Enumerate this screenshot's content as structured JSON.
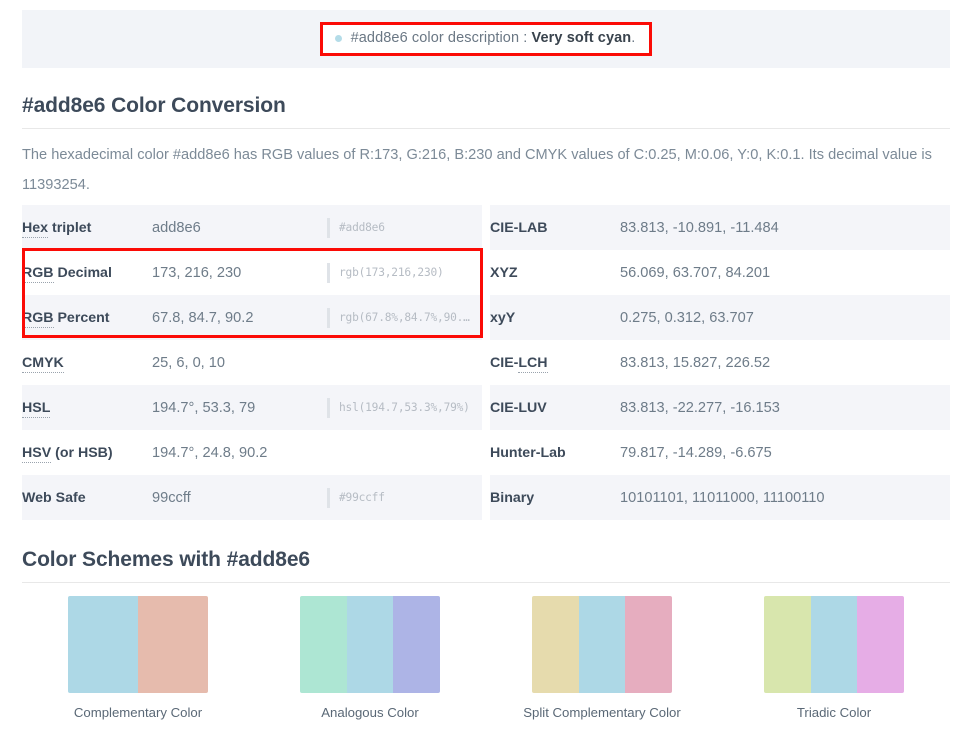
{
  "banner": {
    "bullet": "bullet-dot",
    "prefix": "#add8e6 color description : ",
    "name": "Very soft cyan",
    "suffix": "."
  },
  "conversion": {
    "heading": "#add8e6 Color Conversion",
    "intro": "The hexadecimal color #add8e6 has RGB values of R:173, G:216, B:230 and CMYK values of C:0.25, M:0.06, Y:0, K:0.1. Its decimal value is 11393254.",
    "left_rows": [
      {
        "label": "Hex triplet",
        "label_dotted": "Hex",
        "label_rest": " triplet",
        "value": "add8e6",
        "code": "#add8e6"
      },
      {
        "label": "RGB Decimal",
        "label_dotted": "RGB",
        "label_rest": " Decimal",
        "value": "173, 216, 230",
        "code": "rgb(173,216,230)"
      },
      {
        "label": "RGB Percent",
        "label_dotted": "RGB",
        "label_rest": " Percent",
        "value": "67.8, 84.7, 90.2",
        "code": "rgb(67.8%,84.7%,90.…"
      },
      {
        "label": "CMYK",
        "label_dotted": "CMYK",
        "label_rest": "",
        "value": "25, 6, 0, 10",
        "code": ""
      },
      {
        "label": "HSL",
        "label_dotted": "HSL",
        "label_rest": "",
        "value": "194.7°, 53.3, 79",
        "code": "hsl(194.7,53.3%,79%)"
      },
      {
        "label": "HSV (or HSB)",
        "label_dotted": "HSV",
        "label_rest": " (or HSB)",
        "value": "194.7°, 24.8, 90.2",
        "code": ""
      },
      {
        "label": "Web Safe",
        "label_dotted": "",
        "label_rest": "Web Safe",
        "value": "99ccff",
        "code": "#99ccff"
      }
    ],
    "right_rows": [
      {
        "label": "CIE-LAB",
        "label_dotted": "",
        "label_rest": "CIE-LAB",
        "value": "83.813, -10.891, -11.484",
        "code": ""
      },
      {
        "label": "XYZ",
        "label_dotted": "",
        "label_rest": "XYZ",
        "value": "56.069, 63.707, 84.201",
        "code": ""
      },
      {
        "label": "xyY",
        "label_dotted": "",
        "label_rest": "xyY",
        "value": "0.275, 0.312, 63.707",
        "code": ""
      },
      {
        "label": "CIE-LCH",
        "label_dotted": "",
        "label_rest": "CIE-LCH",
        "value": "83.813, 15.827, 226.52",
        "code": ""
      },
      {
        "label": "CIE-LUV",
        "label_dotted": "",
        "label_rest": "CIE-LUV",
        "value": "83.813, -22.277, -16.153",
        "code": ""
      },
      {
        "label": "Hunter-Lab",
        "label_dotted": "",
        "label_rest": "Hunter-Lab",
        "value": "79.817, -14.289, -6.675",
        "code": ""
      },
      {
        "label": "Binary",
        "label_dotted": "",
        "label_rest": "Binary",
        "value": "10101101, 11011000, 11100110",
        "code": ""
      }
    ]
  },
  "schemes": {
    "heading": "Color Schemes with #add8e6",
    "items": [
      {
        "label": "Complementary Color",
        "colors": [
          "#add8e6",
          "#e6bbad"
        ]
      },
      {
        "label": "Analogous Color",
        "colors": [
          "#ade6d3",
          "#add8e6",
          "#adb4e6"
        ]
      },
      {
        "label": "Split Complementary Color",
        "colors": [
          "#e6dbad",
          "#add8e6",
          "#e6adbf"
        ]
      },
      {
        "label": "Triadic Color",
        "colors": [
          "#d8e6ad",
          "#add8e6",
          "#e6ade6"
        ]
      }
    ]
  },
  "annotations": {
    "accent": "#fb0b06"
  }
}
